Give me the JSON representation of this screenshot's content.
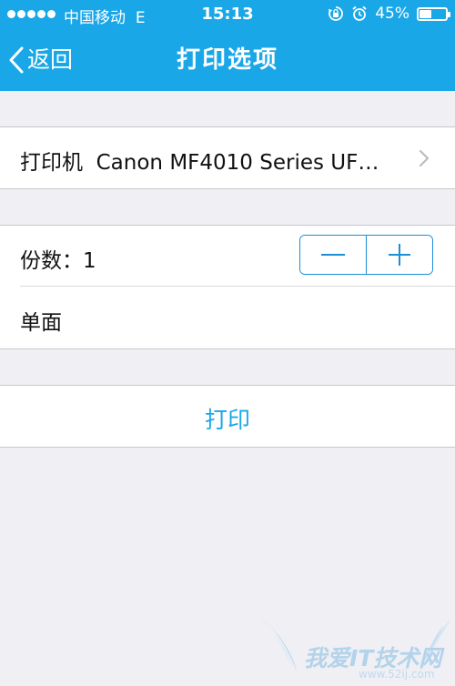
{
  "status_bar": {
    "carrier": "中国移动",
    "network": "E",
    "time": "15:13",
    "battery_percent_text": "45%",
    "battery_level": 0.45,
    "icons": [
      "signal-dots-icon",
      "rotation-lock-icon",
      "alarm-icon",
      "battery-icon"
    ]
  },
  "nav": {
    "back_label": "返回",
    "title": "打印选项"
  },
  "printer": {
    "label": "打印机",
    "value": "Canon MF4010 Series UF…",
    "icon": "chevron-right-icon"
  },
  "copies": {
    "label": "份数：",
    "count": "1",
    "decrement_icon": "minus-icon",
    "increment_icon": "plus-icon"
  },
  "sides": {
    "label": "单面"
  },
  "action": {
    "print_label": "打印"
  },
  "watermark": {
    "text": "我爱IT技术网",
    "url": "www.52ij.com"
  },
  "colors": {
    "header": "#1aa7e8",
    "accent": "#1a8fd6",
    "background": "#efeff4"
  }
}
